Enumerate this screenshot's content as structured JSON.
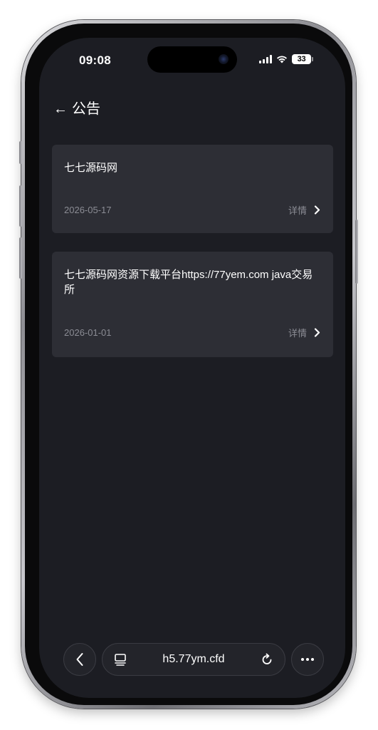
{
  "status_bar": {
    "time": "09:08",
    "battery": "33"
  },
  "header": {
    "back_icon": "arrow-left-icon",
    "title": "公告"
  },
  "announcements": [
    {
      "title": "七七源码网",
      "date": "2026-05-17",
      "detail_label": "详情"
    },
    {
      "title": "七七源码网资源下载平台https://77yem.com java交易所",
      "date": "2026-01-01",
      "detail_label": "详情"
    }
  ],
  "browser_toolbar": {
    "url": "h5.77ym.cfd",
    "icons": [
      "chevron-left-icon",
      "tabs-icon",
      "reload-icon",
      "more-icon"
    ]
  },
  "colors": {
    "background": "#1c1d23",
    "card": "#2d2e35",
    "muted_text": "#8b8c94"
  }
}
